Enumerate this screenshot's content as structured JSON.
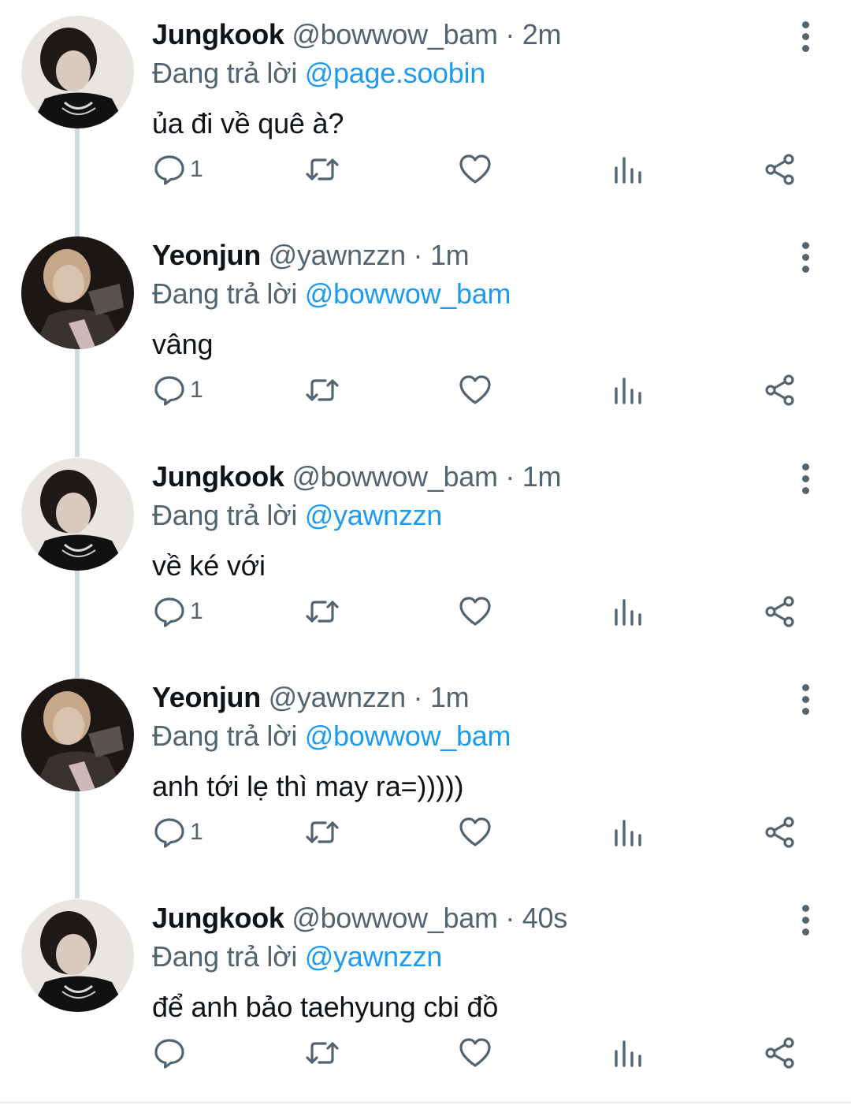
{
  "tweets": [
    {
      "name": "Jungkook",
      "handle": "@bowwow_bam",
      "separator": "·",
      "time": "2m",
      "replying_prefix": "Đang trả lời",
      "replying_to": "@page.soobin",
      "text": "ủa đi về quê à?",
      "reply_count": "1",
      "avatar": "jungkook-avatar"
    },
    {
      "name": "Yeonjun",
      "handle": "@yawnzzn",
      "separator": "·",
      "time": "1m",
      "replying_prefix": "Đang trả lời",
      "replying_to": "@bowwow_bam",
      "text": "vâng",
      "reply_count": "1",
      "avatar": "yeonjun-avatar"
    },
    {
      "name": "Jungkook",
      "handle": "@bowwow_bam",
      "separator": "·",
      "time": "1m",
      "replying_prefix": "Đang trả lời",
      "replying_to": "@yawnzzn",
      "text": "về ké với",
      "reply_count": "1",
      "avatar": "jungkook-avatar"
    },
    {
      "name": "Yeonjun",
      "handle": "@yawnzzn",
      "separator": "·",
      "time": "1m",
      "replying_prefix": "Đang trả lời",
      "replying_to": "@bowwow_bam",
      "text": "anh tới lẹ thì may ra=)))))",
      "reply_count": "1",
      "avatar": "yeonjun-avatar"
    },
    {
      "name": "Jungkook",
      "handle": "@bowwow_bam",
      "separator": "·",
      "time": "40s",
      "replying_prefix": "Đang trả lời",
      "replying_to": "@yawnzzn",
      "text": "để anh bảo taehyung cbi đồ",
      "reply_count": "",
      "avatar": "jungkook-avatar"
    }
  ],
  "icons": {
    "reply": "reply-icon",
    "retweet": "retweet-icon",
    "like": "heart-icon",
    "views": "views-icon",
    "share": "share-icon",
    "more": "more-options-icon"
  },
  "colors": {
    "text": "#0f1419",
    "secondary": "#536471",
    "link": "#1d9bf0",
    "thread_line": "#cfd9de"
  }
}
